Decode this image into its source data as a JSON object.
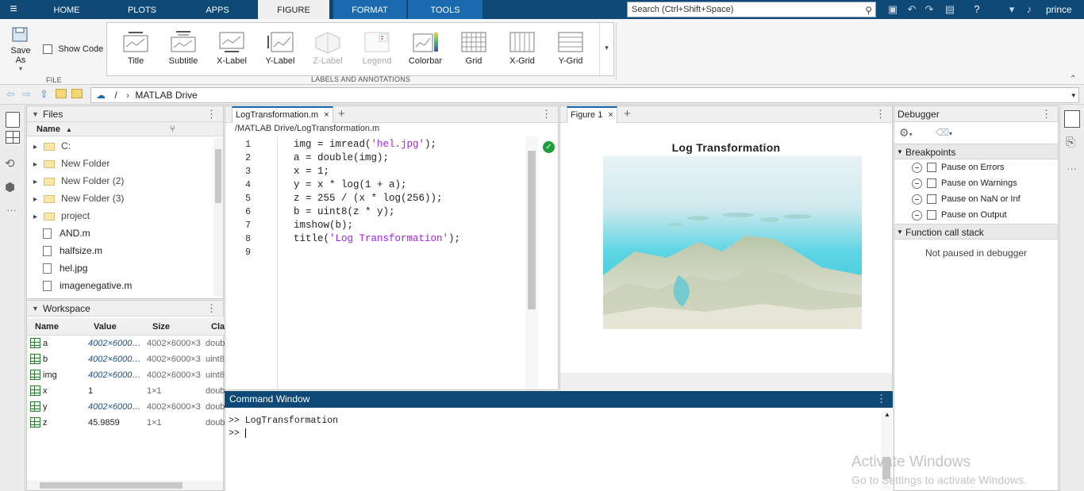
{
  "top_tabs": [
    "HOME",
    "PLOTS",
    "APPS",
    "FIGURE",
    "FORMAT",
    "TOOLS"
  ],
  "active_tab": "FIGURE",
  "search": {
    "placeholder": "Search (Ctrl+Shift+Space)"
  },
  "user": "prince",
  "file_section": {
    "save_as": "Save As",
    "show_code": "Show Code",
    "label": "FILE"
  },
  "labels_section": {
    "label": "LABELS AND ANNOTATIONS",
    "tools": [
      {
        "label": "Title",
        "icon": "title-icon",
        "enabled": true
      },
      {
        "label": "Subtitle",
        "icon": "subtitle-icon",
        "enabled": true
      },
      {
        "label": "X-Label",
        "icon": "xlabel-icon",
        "enabled": true
      },
      {
        "label": "Y-Label",
        "icon": "ylabel-icon",
        "enabled": true
      },
      {
        "label": "Z-Label",
        "icon": "zlabel-icon",
        "enabled": false
      },
      {
        "label": "Legend",
        "icon": "legend-icon",
        "enabled": false
      },
      {
        "label": "Colorbar",
        "icon": "colorbar-icon",
        "enabled": true
      },
      {
        "label": "Grid",
        "icon": "grid-icon",
        "enabled": true
      },
      {
        "label": "X-Grid",
        "icon": "xgrid-icon",
        "enabled": true
      },
      {
        "label": "Y-Grid",
        "icon": "ygrid-icon",
        "enabled": true
      }
    ]
  },
  "address": {
    "root": "/",
    "sep": "›",
    "folder": "MATLAB Drive"
  },
  "files": {
    "title": "Files",
    "column": "Name",
    "items": [
      {
        "name": "C:",
        "type": "folder"
      },
      {
        "name": "New Folder",
        "type": "folder"
      },
      {
        "name": "New Folder (2)",
        "type": "folder"
      },
      {
        "name": "New Folder (3)",
        "type": "folder"
      },
      {
        "name": "project",
        "type": "folder"
      },
      {
        "name": "AND.m",
        "type": "file"
      },
      {
        "name": "halfsize.m",
        "type": "file"
      },
      {
        "name": "hel.jpg",
        "type": "image"
      },
      {
        "name": "imagenegative.m",
        "type": "file"
      }
    ]
  },
  "workspace": {
    "title": "Workspace",
    "columns": [
      "Name",
      "Value",
      "Size",
      "Cla"
    ],
    "rows": [
      {
        "name": "a",
        "value": "4002×6000…",
        "size": "4002×6000×3",
        "cls": "doub",
        "italic": true
      },
      {
        "name": "b",
        "value": "4002×6000…",
        "size": "4002×6000×3",
        "cls": "uint8",
        "italic": true
      },
      {
        "name": "img",
        "value": "4002×6000…",
        "size": "4002×6000×3",
        "cls": "uint8",
        "italic": true
      },
      {
        "name": "x",
        "value": "1",
        "size": "1×1",
        "cls": "doub",
        "italic": false
      },
      {
        "name": "y",
        "value": "4002×6000…",
        "size": "4002×6000×3",
        "cls": "doub",
        "italic": true
      },
      {
        "name": "z",
        "value": "45.9859",
        "size": "1×1",
        "cls": "doub",
        "italic": false
      }
    ]
  },
  "editor": {
    "tab": "LogTransformation.m",
    "path": "/MATLAB Drive/LogTransformation.m",
    "lines": [
      {
        "n": "1",
        "pre": "img = imread(",
        "str": "'hel.jpg'",
        "post": ");"
      },
      {
        "n": "2",
        "pre": "a = double(img);",
        "str": "",
        "post": ""
      },
      {
        "n": "3",
        "pre": "x = 1;",
        "str": "",
        "post": ""
      },
      {
        "n": "4",
        "pre": "y = x * log(1 + a);",
        "str": "",
        "post": ""
      },
      {
        "n": "5",
        "pre": "z = 255 / (x * log(256));",
        "str": "",
        "post": ""
      },
      {
        "n": "6",
        "pre": "b = uint8(z * y);",
        "str": "",
        "post": ""
      },
      {
        "n": "7",
        "pre": "imshow(b);",
        "str": "",
        "post": ""
      },
      {
        "n": "8",
        "pre": "title(",
        "str": "'Log Transformation'",
        "post": ");"
      },
      {
        "n": "9",
        "pre": "",
        "str": "",
        "post": ""
      }
    ]
  },
  "figure": {
    "tab": "Figure 1",
    "title": "Log Transformation"
  },
  "command_window": {
    "title": "Command Window",
    "lines": [
      ">> LogTransformation",
      ">> "
    ]
  },
  "debugger": {
    "title": "Debugger",
    "breakpoints_label": "Breakpoints",
    "breakpoints": [
      "Pause on Errors",
      "Pause on Warnings",
      "Pause on NaN or Inf",
      "Pause on Output"
    ],
    "call_stack_label": "Function call stack",
    "status": "Not paused in debugger"
  },
  "watermark": {
    "line1": "Activate Windows",
    "line2": "Go to Settings to activate Windows."
  },
  "colors": {
    "brand": "#0e4877",
    "string": "#a020f0",
    "ok": "#1e9e3a"
  }
}
